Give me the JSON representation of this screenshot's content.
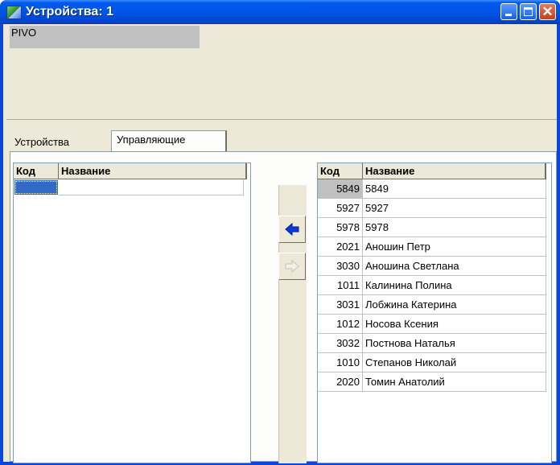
{
  "window": {
    "title": "Устройства: 1"
  },
  "device": {
    "name": "PIVO"
  },
  "tabs": [
    {
      "label": "Устройства",
      "active": false
    },
    {
      "label": "Управляющие",
      "active": true
    }
  ],
  "left_grid": {
    "columns": [
      "Код",
      "Название"
    ],
    "rows": []
  },
  "right_grid": {
    "columns": [
      "Код",
      "Название"
    ],
    "rows": [
      {
        "code": "5849",
        "name": "5849"
      },
      {
        "code": "5927",
        "name": "5927"
      },
      {
        "code": "5978",
        "name": "5978"
      },
      {
        "code": "2021",
        "name": "Аношин Петр"
      },
      {
        "code": "3030",
        "name": "Аношина Светлана"
      },
      {
        "code": "1011",
        "name": "Калинина Полина"
      },
      {
        "code": "3031",
        "name": "Лобжина Катерина"
      },
      {
        "code": "1012",
        "name": "Носова Ксения"
      },
      {
        "code": "3032",
        "name": "Постнова Наталья"
      },
      {
        "code": "1010",
        "name": "Степанов Николай"
      },
      {
        "code": "2020",
        "name": "Томин Анатолий"
      }
    ]
  },
  "buttons": {
    "add_icon": "arrow-left-blue-icon",
    "remove_icon": "arrow-right-disabled-icon"
  },
  "colors": {
    "titlebar": "#0055e5",
    "selection": "#316ac5",
    "arrow_active": "#0a3adc",
    "arrow_disabled": "#c6c2b5"
  }
}
